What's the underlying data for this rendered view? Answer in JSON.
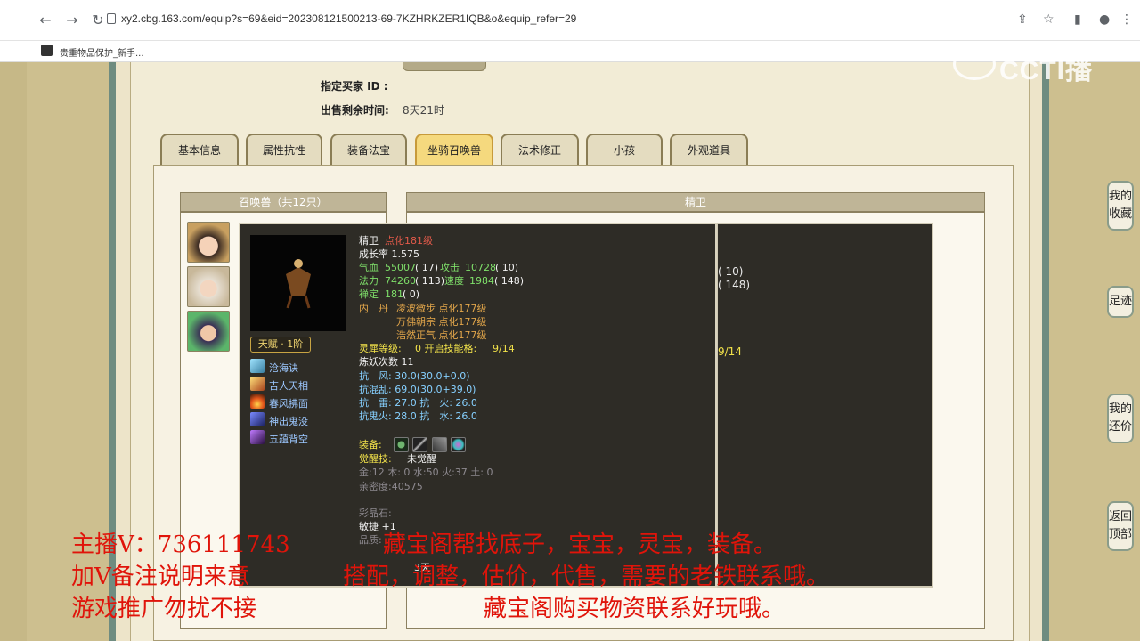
{
  "browser": {
    "url": "xy2.cbg.163.com/equip?s=69&eid=202308121500213-69-7KZHRKZER1IQB&o&equip_refer=29",
    "bookmark": "贵重物品保护_新手..."
  },
  "info": {
    "buyer_label": "指定买家 ID :",
    "remain_label": "出售剩余时间:",
    "remain_value": "8天21时"
  },
  "tabs": [
    "基本信息",
    "属性抗性",
    "装备法宝",
    "坐骑召唤兽",
    "法术修正",
    "小孩",
    "外观道具"
  ],
  "pet_list": {
    "header": "召唤兽（共12只）"
  },
  "detail": {
    "header": "精卫",
    "peek": [
      "( 10)",
      "( 148)",
      "9/14"
    ]
  },
  "tooltip": {
    "name": "精卫",
    "level": "点化181级",
    "growth": "成长率 1.575",
    "hp_l": "气血",
    "hp_v": "55007",
    "hp_p": "( 17)",
    "atk_l": "攻击",
    "atk_v": "10728",
    "atk_p": "( 10)",
    "mp_l": "法力",
    "mp_v": "74260",
    "mp_p": "( 113)",
    "spd_l": "速度",
    "spd_v": "1984",
    "spd_p": "( 148)",
    "chan_l": "禅定",
    "chan_v": "181",
    "chan_p": "( 0)",
    "neidan_l": "内　丹",
    "neidan": [
      "凌波微步 点化177级",
      "万佛朝宗 点化177级",
      "浩然正气 点化177级"
    ],
    "lingxi_l": "灵犀等级:",
    "lingxi_v": "0 开启技能格:",
    "lingxi_s": "9/14",
    "lianyao": "炼妖次数 11",
    "res": [
      "抗　风: 30.0(30.0+0.0)",
      "抗混乱: 69.0(30.0+39.0)",
      "抗　雷: 27.0 抗　火: 26.0",
      "抗鬼火: 28.0 抗　水: 26.0"
    ],
    "equip_l": "装备:",
    "awaken_l": "觉醒技:",
    "awaken_v": "未觉醒",
    "elements": "金:12 木: 0 水:50 火:37 土: 0",
    "intimacy": "亲密度:40575",
    "caijing": "彩晶石:",
    "agility": "敏捷 +1",
    "quality": "品质:",
    "timer": "3天",
    "talent": "天赋 · 1阶",
    "skills": [
      "沧海诀",
      "吉人天相",
      "春风拂面",
      "神出鬼没",
      "五蕴背空"
    ]
  },
  "side_buttons": [
    "我的收藏",
    "足迹",
    "我的还价",
    "返回顶部"
  ],
  "watermark": "CCTI播",
  "captions": {
    "l1": "主播V：736111743",
    "l2": "加V备注说明来意",
    "l3": "游戏推广勿扰不接",
    "r1": "藏宝阁帮找底子，宝宝，灵宝，装备。",
    "r2": "搭配，调整，估价，代售，需要的老铁联系哦。",
    "r3": "藏宝阁购买物资联系好玩哦。"
  },
  "colors": {
    "caption": "#e0140a",
    "tab_active": "#f5d97e",
    "tooltip_bg": "#2e2c26"
  }
}
